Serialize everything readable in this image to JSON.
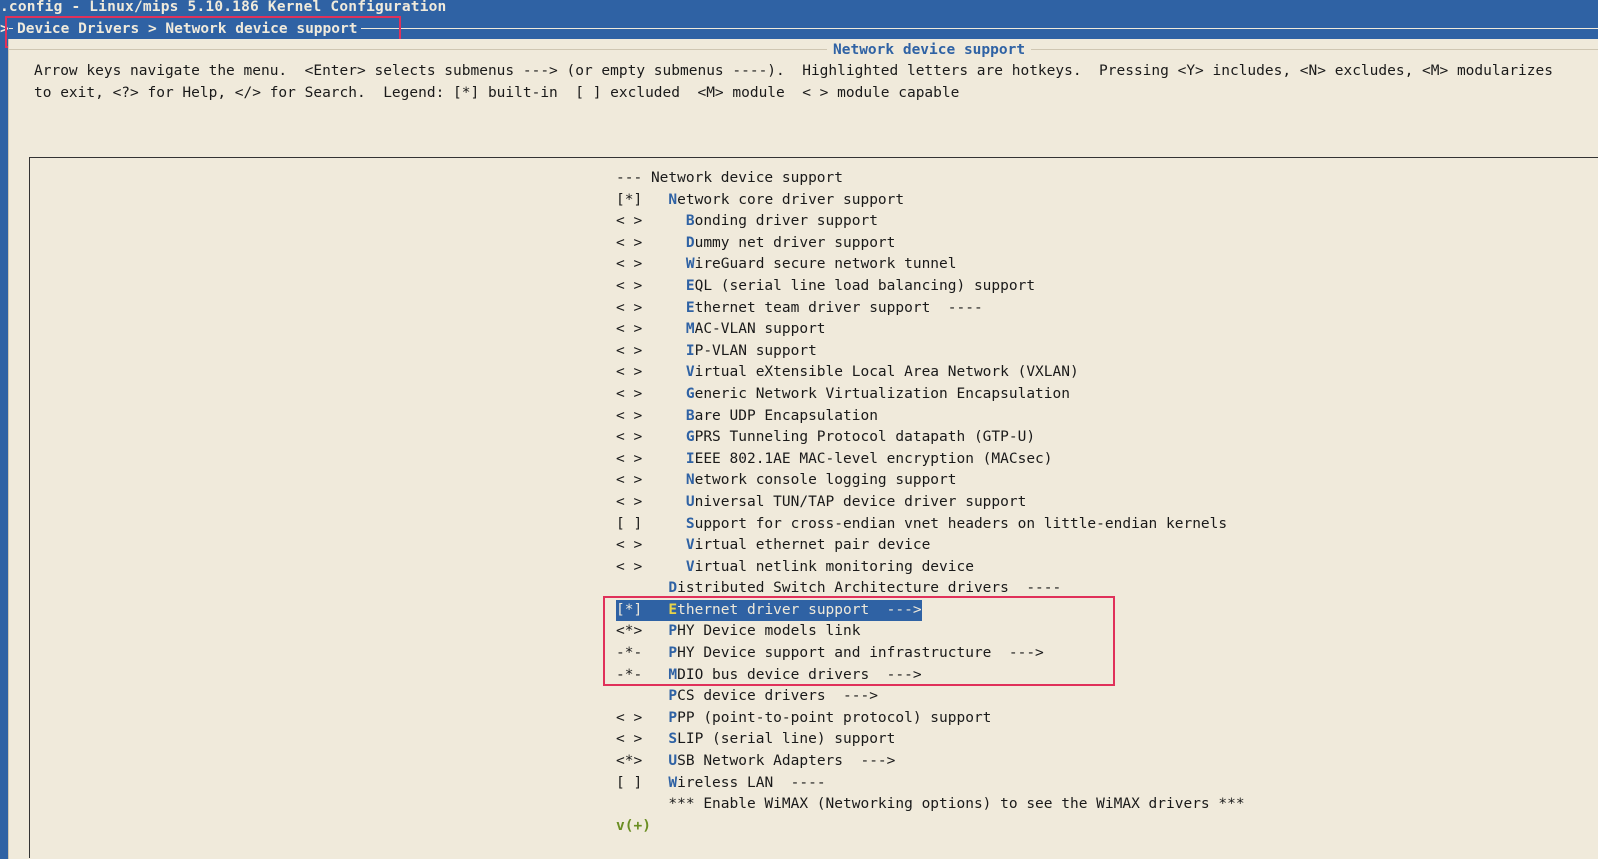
{
  "window": {
    "title": ".config - Linux/mips 5.10.186 Kernel Configuration"
  },
  "breadcrumb": {
    "arrow": ">",
    "text": "Device Drivers > Network device support"
  },
  "dialog": {
    "title": "Network device support",
    "help_line_1": "Arrow keys navigate the menu.  <Enter> selects submenus ---> (or empty submenus ----).  Highlighted letters are hotkeys.  Pressing <Y> includes, <N> excludes, <M> modularizes",
    "help_line_2": "to exit, <?> for Help, </> for Search.  Legend: [*] built-in  [ ] excluded  <M> module  < > module capable"
  },
  "menu": {
    "items": [
      {
        "mark": "---",
        "indent": 0,
        "hot": "",
        "rest": "Network device support"
      },
      {
        "mark": "[*]",
        "indent": 1,
        "hot": "N",
        "rest": "etwork core driver support"
      },
      {
        "mark": "< >",
        "indent": 2,
        "hot": "B",
        "rest": "onding driver support"
      },
      {
        "mark": "< >",
        "indent": 2,
        "hot": "D",
        "rest": "ummy net driver support"
      },
      {
        "mark": "< >",
        "indent": 2,
        "hot": "W",
        "rest": "ireGuard secure network tunnel"
      },
      {
        "mark": "< >",
        "indent": 2,
        "hot": "E",
        "rest": "QL (serial line load balancing) support"
      },
      {
        "mark": "< >",
        "indent": 2,
        "hot": "E",
        "rest": "thernet team driver support  ----"
      },
      {
        "mark": "< >",
        "indent": 2,
        "hot": "M",
        "rest": "AC-VLAN support"
      },
      {
        "mark": "< >",
        "indent": 2,
        "hot": "I",
        "rest": "P-VLAN support"
      },
      {
        "mark": "< >",
        "indent": 2,
        "hot": "V",
        "rest": "irtual eXtensible Local Area Network (VXLAN)"
      },
      {
        "mark": "< >",
        "indent": 2,
        "hot": "G",
        "rest": "eneric Network Virtualization Encapsulation"
      },
      {
        "mark": "< >",
        "indent": 2,
        "hot": "B",
        "rest": "are UDP Encapsulation"
      },
      {
        "mark": "< >",
        "indent": 2,
        "hot": "G",
        "rest": "PRS Tunneling Protocol datapath (GTP-U)"
      },
      {
        "mark": "< >",
        "indent": 2,
        "hot": "I",
        "rest": "EEE 802.1AE MAC-level encryption (MACsec)"
      },
      {
        "mark": "< >",
        "indent": 2,
        "hot": "N",
        "rest": "etwork console logging support"
      },
      {
        "mark": "< >",
        "indent": 2,
        "hot": "U",
        "rest": "niversal TUN/TAP device driver support"
      },
      {
        "mark": "[ ]",
        "indent": 2,
        "hot": "S",
        "rest": "upport for cross-endian vnet headers on little-endian kernels"
      },
      {
        "mark": "< >",
        "indent": 2,
        "hot": "V",
        "rest": "irtual ethernet pair device"
      },
      {
        "mark": "< >",
        "indent": 2,
        "hot": "V",
        "rest": "irtual netlink monitoring device"
      },
      {
        "mark": "   ",
        "indent": 1,
        "hot": "D",
        "rest": "istributed Switch Architecture drivers  ----"
      },
      {
        "mark": "[*]",
        "indent": 1,
        "hot": "E",
        "rest": "thernet driver support  --->",
        "selected": true
      },
      {
        "mark": "<*>",
        "indent": 1,
        "hot": "P",
        "rest": "HY Device models link"
      },
      {
        "mark": "-*-",
        "indent": 1,
        "hot": "P",
        "rest": "HY Device support and infrastructure  --->"
      },
      {
        "mark": "-*-",
        "indent": 1,
        "hot": "M",
        "rest": "DIO bus device drivers  --->"
      },
      {
        "mark": "   ",
        "indent": 1,
        "hot": "P",
        "rest": "CS device drivers  --->"
      },
      {
        "mark": "< >",
        "indent": 1,
        "hot": "P",
        "rest": "PP (point-to-point protocol) support"
      },
      {
        "mark": "< >",
        "indent": 1,
        "hot": "S",
        "rest": "LIP (serial line) support"
      },
      {
        "mark": "<*>",
        "indent": 1,
        "hot": "U",
        "rest": "SB Network Adapters  --->"
      },
      {
        "mark": "[ ]",
        "indent": 1,
        "hot": "W",
        "rest": "ireless LAN  ----"
      },
      {
        "mark": "   ",
        "indent": 1,
        "hot": "",
        "rest": "*** Enable WiMAX (Networking options) to see the WiMAX drivers ***"
      }
    ],
    "scroll_indicator": "v(+)"
  },
  "colors": {
    "background_blue": "#2f62a4",
    "dialog_beige": "#f0eadb",
    "annotation_red": "#e0315a",
    "hotkey_yellow": "#e8d44a"
  }
}
